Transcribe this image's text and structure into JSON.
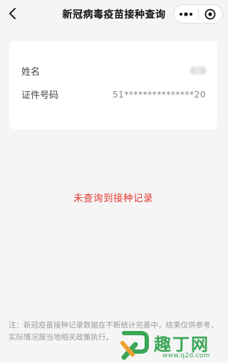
{
  "navbar": {
    "title": "新冠病毒疫苗接种查询",
    "back_icon": "chevron-left-icon",
    "more_icon": "more-dots-icon",
    "close_icon": "target-close-icon"
  },
  "card": {
    "name_label": "姓名",
    "id_label": "证件号码",
    "id_value": "51***************20"
  },
  "result": {
    "message": "未查询到接种记录",
    "color": "#e23b33"
  },
  "note": "注：新冠疫苗接种记录数据在不断统计完善中，结果仅供参考，实际情况按当地相关政策执行。",
  "watermark": {
    "text": "趣丁网",
    "url": "www.q2d.com",
    "color": "#3aa655"
  }
}
